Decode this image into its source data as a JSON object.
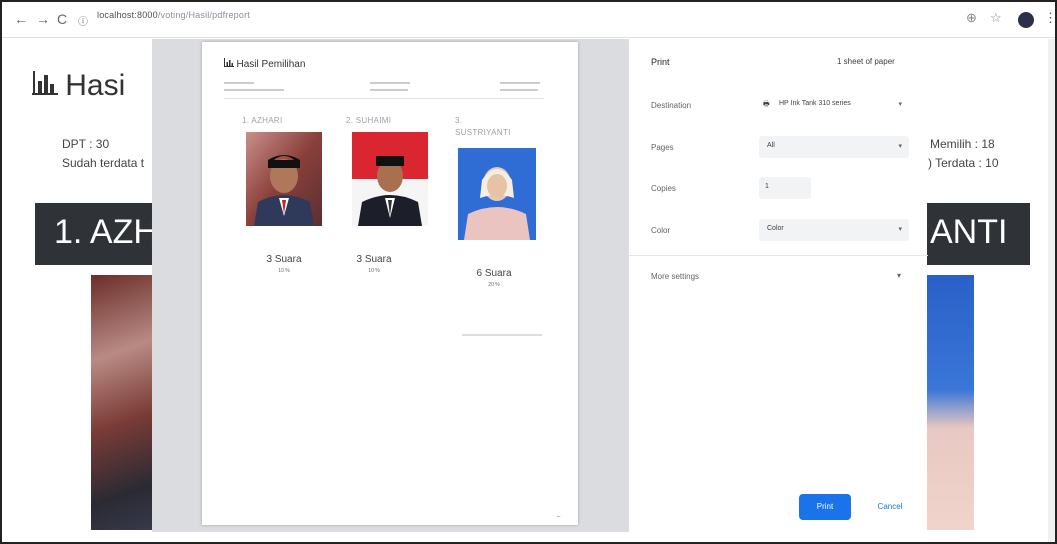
{
  "browser": {
    "back_icon": "←",
    "forward_icon": "→",
    "reload_icon": "C",
    "url_host": "localhost:8000",
    "url_path": "/voting/Hasil/pdfreport",
    "zoom_icon": "⊕",
    "star_icon": "☆",
    "menu_icon": "⋮"
  },
  "page": {
    "title": "Hasi",
    "stats": {
      "dpt": "DPT : 30",
      "sudah_terdata": "Sudah terdata t",
      "memilih": "Memilih : 18",
      "terdata": ") Terdata : 10"
    },
    "banner_left": "1. AZH",
    "banner_right": "ANTI"
  },
  "preview": {
    "title": "Hasil Pemilihan",
    "candidates": [
      {
        "name": "1. AZHARI",
        "votes": "3 Suara",
        "pct": "10 %"
      },
      {
        "name": "2. SUHAIMI",
        "votes": "3 Suara",
        "pct": "10 %"
      },
      {
        "name_line1": "3.",
        "name_line2": "SUSTRIYANTI",
        "votes": "6 Suara",
        "pct": "20 %"
      }
    ]
  },
  "print": {
    "header_label": "Print",
    "sheets": "1 sheet of paper",
    "destination_label": "Destination",
    "destination_value": "HP Ink Tank 310 series",
    "pages_label": "Pages",
    "pages_value": "All",
    "copies_label": "Copies",
    "copies_value": "1",
    "color_label": "Color",
    "color_value": "Color",
    "more_settings": "More settings",
    "print_button": "Print",
    "cancel_button": "Cancel"
  }
}
